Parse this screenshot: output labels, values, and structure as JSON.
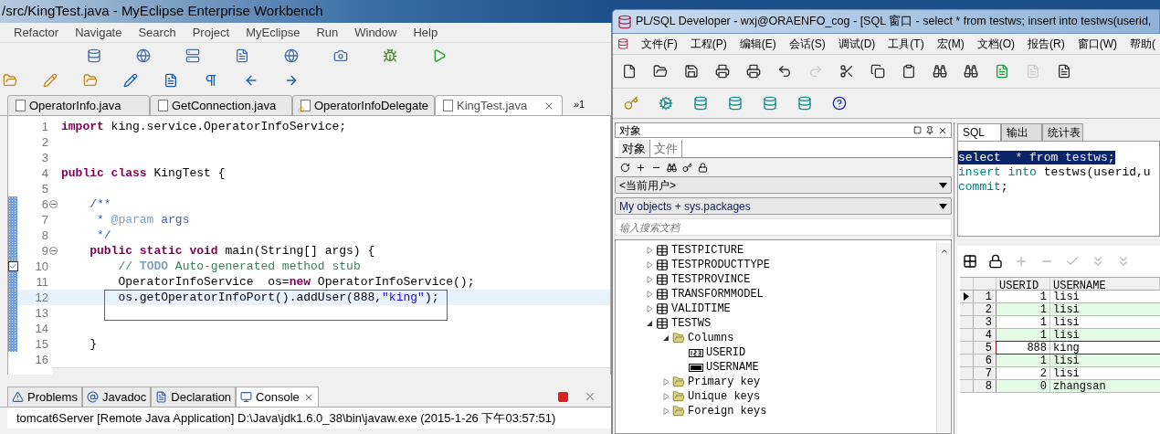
{
  "eclipse": {
    "title": "/src/KingTest.java - MyEclipse Enterprise Workbench",
    "menu": [
      "Refactor",
      "Navigate",
      "Search",
      "Project",
      "MyEclipse",
      "Run",
      "Window",
      "Help"
    ],
    "tabs": [
      {
        "label": "OperatorInfo.java",
        "selected": false,
        "warning": false
      },
      {
        "label": "GetConnection.java",
        "selected": false,
        "warning": false
      },
      {
        "label": "OperatorInfoDelegate",
        "selected": false,
        "warning": true
      },
      {
        "label": "KingTest.java",
        "selected": true,
        "warning": false
      }
    ],
    "tab_overflow": "»1",
    "code": [
      {
        "number": "1",
        "changed": false,
        "fold": false,
        "task": false,
        "current": false,
        "boxed": false,
        "tokens": [
          {
            "kind": "keyword",
            "text": "import"
          },
          {
            "kind": "plain",
            "text": " king.service.OperatorInfoService;"
          }
        ]
      },
      {
        "number": "2",
        "changed": false,
        "fold": false,
        "task": false,
        "current": false,
        "boxed": false
      },
      {
        "number": "3",
        "changed": false,
        "fold": false,
        "task": false,
        "current": false,
        "boxed": false
      },
      {
        "number": "4",
        "changed": false,
        "fold": false,
        "task": false,
        "current": false,
        "boxed": false,
        "tokens": [
          {
            "kind": "keyword",
            "text": "public class"
          },
          {
            "kind": "plain",
            "text": " KingTest {"
          }
        ]
      },
      {
        "number": "5",
        "changed": false,
        "fold": false,
        "task": false,
        "current": false,
        "boxed": false
      },
      {
        "number": "6",
        "changed": true,
        "fold": true,
        "task": false,
        "current": false,
        "boxed": false,
        "tokens": [
          {
            "kind": "javadoc",
            "text": "    /**"
          }
        ]
      },
      {
        "number": "7",
        "changed": true,
        "fold": false,
        "task": false,
        "current": false,
        "boxed": false,
        "tokens": [
          {
            "kind": "javadoc",
            "text": "     * "
          },
          {
            "kind": "tag",
            "text": "@param"
          },
          {
            "kind": "javadoc",
            "text": " args"
          }
        ]
      },
      {
        "number": "8",
        "changed": true,
        "fold": false,
        "task": false,
        "current": false,
        "boxed": false,
        "tokens": [
          {
            "kind": "javadoc",
            "text": "     */"
          }
        ]
      },
      {
        "number": "9",
        "changed": true,
        "fold": true,
        "task": false,
        "current": false,
        "boxed": false,
        "tokens": [
          {
            "kind": "keyword",
            "text": "    public static void"
          },
          {
            "kind": "plain",
            "text": " main(String[] args) {"
          }
        ]
      },
      {
        "number": "10",
        "changed": true,
        "fold": false,
        "task": true,
        "current": false,
        "boxed": false,
        "tokens": [
          {
            "kind": "comment",
            "text": "        // "
          },
          {
            "kind": "todo",
            "text": "TODO"
          },
          {
            "kind": "comment",
            "text": " Auto-generated method stub"
          }
        ]
      },
      {
        "number": "11",
        "changed": true,
        "fold": false,
        "task": false,
        "current": false,
        "boxed": false,
        "tokens": [
          {
            "kind": "plain",
            "text": "        OperatorInfoService  os="
          },
          {
            "kind": "keyword",
            "text": "new"
          },
          {
            "kind": "plain",
            "text": " OperatorInfoService();"
          }
        ]
      },
      {
        "number": "12",
        "changed": true,
        "fold": false,
        "task": false,
        "current": true,
        "boxed": true,
        "tokens": [
          {
            "kind": "plain",
            "text": "        os.getOperatorInfoPort().addUser(888,"
          },
          {
            "kind": "string",
            "text": "\"king\""
          },
          {
            "kind": "plain",
            "text": ");"
          }
        ]
      },
      {
        "number": "13",
        "changed": true,
        "fold": false,
        "task": false,
        "current": false,
        "boxed": false
      },
      {
        "number": "14",
        "changed": true,
        "fold": false,
        "task": false,
        "current": false,
        "boxed": false
      },
      {
        "number": "15",
        "changed": true,
        "fold": false,
        "task": false,
        "current": false,
        "boxed": false,
        "tokens": [
          {
            "kind": "plain",
            "text": "    }"
          }
        ]
      },
      {
        "number": "16",
        "changed": false,
        "fold": false,
        "task": false,
        "current": false,
        "boxed": false
      }
    ],
    "bottom_tabs": [
      {
        "label": "Problems",
        "selected": false
      },
      {
        "label": "Javadoc",
        "selected": false
      },
      {
        "label": "Declaration",
        "selected": false
      },
      {
        "label": "Console",
        "selected": true
      }
    ],
    "console_header": "tomcat6Server [Remote Java Application] D:\\Java\\jdk1.6.0_38\\bin\\javaw.exe (2015-1-26 下午03:57:51)"
  },
  "plsql": {
    "title": "PL/SQL Developer - wxj@ORAENFO_cog - [SQL 窗口 - select * from testws; insert into testws(userid,",
    "menu": [
      "文件(F)",
      "工程(P)",
      "编辑(E)",
      "会话(S)",
      "调试(D)",
      "工具(T)",
      "宏(M)",
      "文档(O)",
      "报告(R)",
      "窗口(W)",
      "帮助("
    ],
    "object_panel": {
      "title": "对象",
      "tabs": [
        {
          "label": "对象",
          "selected": true
        },
        {
          "label": "文件",
          "selected": false
        }
      ],
      "user_select": "<当前用户>",
      "filter_select": "My objects + sys.packages",
      "search": {
        "placeholder": "输入搜索文档"
      },
      "tree": [
        {
          "label": "TESTPICTURE",
          "kind": "table",
          "expanded": false
        },
        {
          "label": "TESTPRODUCTTYPE",
          "kind": "table",
          "expanded": false
        },
        {
          "label": "TESTPROVINCE",
          "kind": "table",
          "expanded": false
        },
        {
          "label": "TRANSFORMMODEL",
          "kind": "table",
          "expanded": false
        },
        {
          "label": "VALIDTIME",
          "kind": "table",
          "expanded": false
        },
        {
          "label": "TESTWS",
          "kind": "table",
          "expanded": true,
          "children": [
            {
              "label": "Columns",
              "kind": "folder",
              "expanded": true,
              "children": [
                {
                  "label": "USERID",
                  "kind": "number"
                },
                {
                  "label": "USERNAME",
                  "kind": "text"
                }
              ]
            },
            {
              "label": "Primary key",
              "kind": "folder",
              "expanded": false
            },
            {
              "label": "Unique keys",
              "kind": "folder",
              "expanded": false
            },
            {
              "label": "Foreign keys",
              "kind": "folder",
              "expanded": false
            }
          ]
        }
      ]
    },
    "sql_tabs": [
      {
        "label": "SQL",
        "selected": true
      },
      {
        "label": "输出",
        "selected": false
      },
      {
        "label": "统计表",
        "selected": false
      }
    ],
    "sql_lines": [
      {
        "selected": true,
        "tokens": [
          {
            "kind": "keyword",
            "text": "select"
          },
          {
            "kind": "plain",
            "text": "  * "
          },
          {
            "kind": "keyword",
            "text": "from"
          },
          {
            "kind": "plain",
            "text": " testws;"
          }
        ]
      },
      {
        "selected": false,
        "tokens": [
          {
            "kind": "keyword",
            "text": "insert into"
          },
          {
            "kind": "plain",
            "text": " testws(userid,u"
          }
        ]
      },
      {
        "selected": false,
        "tokens": [
          {
            "kind": "keyword",
            "text": "commit"
          },
          {
            "kind": "plain",
            "text": ";"
          }
        ]
      }
    ],
    "grid": {
      "columns": [
        "USERID",
        "USERNAME"
      ],
      "rows": [
        {
          "number": "1",
          "userid": "1",
          "username": "lisi",
          "current": true,
          "highlighted": false
        },
        {
          "number": "2",
          "userid": "1",
          "username": "lisi",
          "current": false,
          "highlighted": false
        },
        {
          "number": "3",
          "userid": "1",
          "username": "lisi",
          "current": false,
          "highlighted": false
        },
        {
          "number": "4",
          "userid": "1",
          "username": "lisi",
          "current": false,
          "highlighted": false
        },
        {
          "number": "5",
          "userid": "888",
          "username": "king",
          "current": false,
          "highlighted": true
        },
        {
          "number": "6",
          "userid": "1",
          "username": "lisi",
          "current": false,
          "highlighted": false
        },
        {
          "number": "7",
          "userid": "2",
          "username": "lisi",
          "current": false,
          "highlighted": false
        },
        {
          "number": "8",
          "userid": "0",
          "username": "zhangsan",
          "current": false,
          "highlighted": false
        }
      ]
    }
  }
}
